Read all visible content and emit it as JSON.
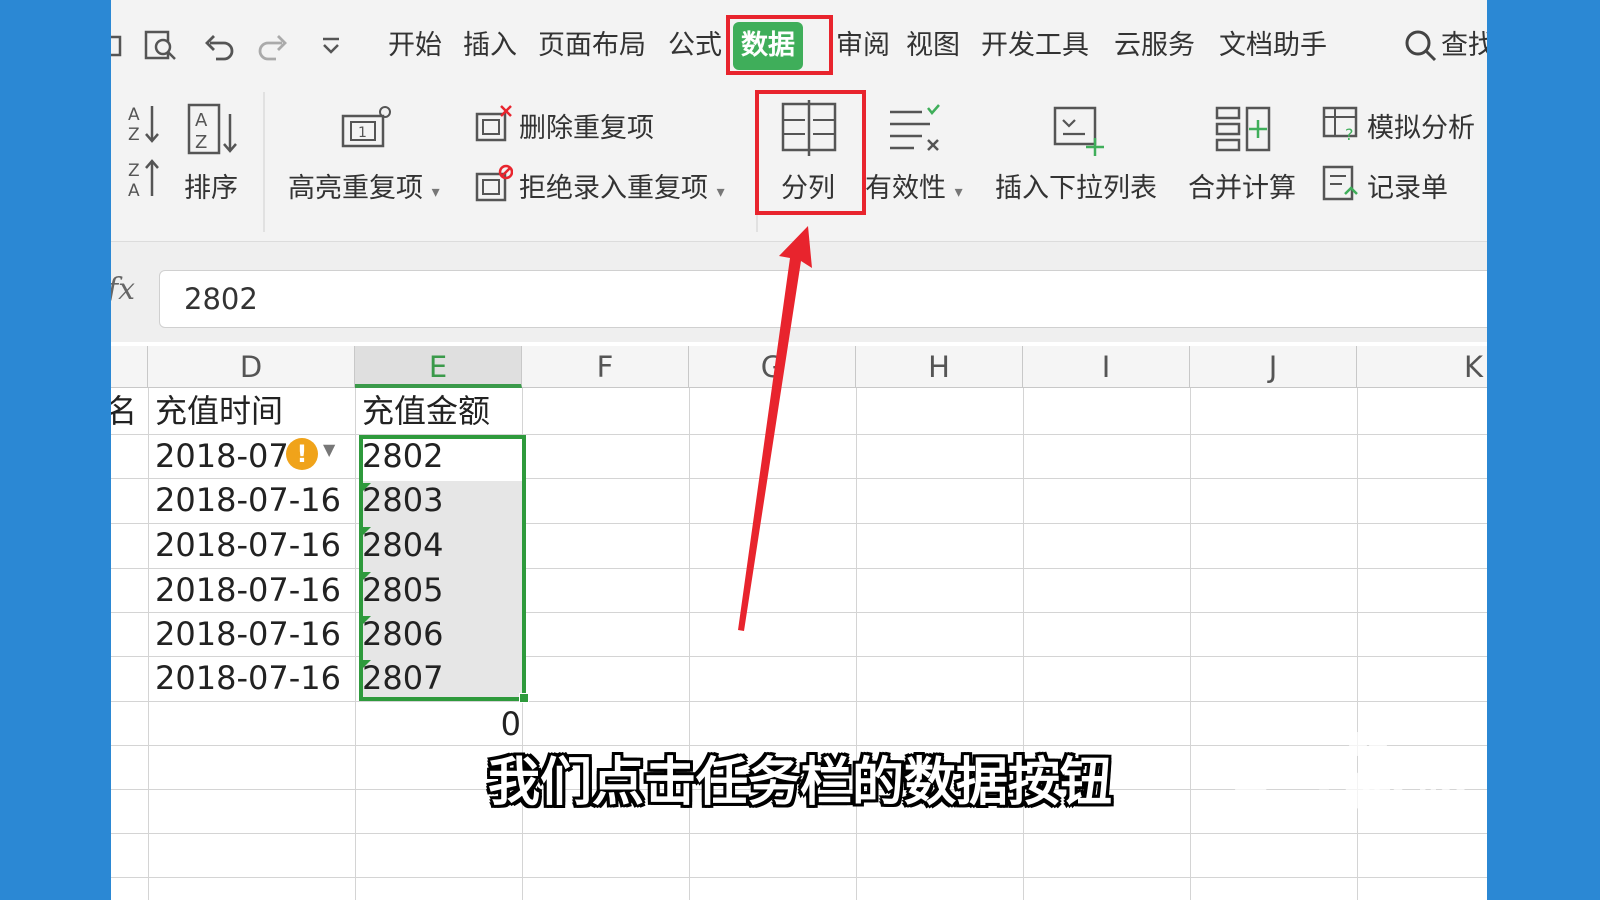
{
  "menubar": {
    "items": [
      "开始",
      "插入",
      "页面布局",
      "公式",
      "数据",
      "审阅",
      "视图",
      "开发工具",
      "云服务",
      "文档助手"
    ],
    "active": "数据",
    "search_label": "查找"
  },
  "ribbon": {
    "sort_label": "排序",
    "highlight_dup_label": "高亮重复项",
    "remove_dup_label": "删除重复项",
    "reject_dup_label": "拒绝录入重复项",
    "split_label": "分列",
    "validity_label": "有效性",
    "dropdown_label": "插入下拉列表",
    "consolidate_label": "合并计算",
    "simulate_label": "模拟分析",
    "record_label": "记录单"
  },
  "formula_bar": {
    "fx_label": "fx",
    "value": "2802"
  },
  "columns": [
    "D",
    "E",
    "F",
    "G",
    "H",
    "I",
    "J",
    "K"
  ],
  "selected_column": "E",
  "table": {
    "partial_header": "名",
    "header_d": "充值时间",
    "header_e": "充值金额",
    "first_date_partial": "2018-07",
    "rows": [
      {
        "date": "2018-07-16",
        "amount": "2802"
      },
      {
        "date": "2018-07-16",
        "amount": "2803"
      },
      {
        "date": "2018-07-16",
        "amount": "2804"
      },
      {
        "date": "2018-07-16",
        "amount": "2805"
      },
      {
        "date": "2018-07-16",
        "amount": "2806"
      },
      {
        "date": "2018-07-16",
        "amount": "2807"
      }
    ],
    "sum_value": "0"
  },
  "subtitle": "我们点击任务栏的数据按钮",
  "watermark": {
    "brand": "Bai 经验",
    "url": "jingyan.baidu.com"
  },
  "colors": {
    "frame_blue": "#2b88d4",
    "active_tab_green": "#3fae5a",
    "highlight_red": "#e8242d",
    "selection_green": "#2e9a3c"
  }
}
